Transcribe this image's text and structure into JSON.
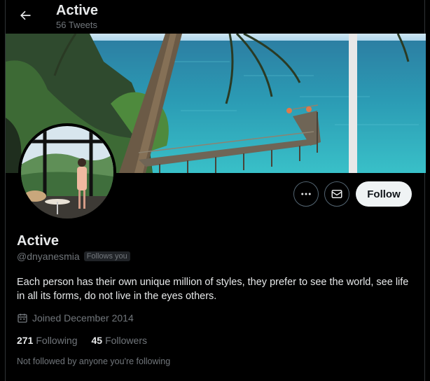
{
  "header": {
    "title": "Active",
    "tweet_count": "56 Tweets"
  },
  "actions": {
    "follow_label": "Follow"
  },
  "profile": {
    "name": "Active",
    "handle": "@dnyanesmia",
    "follows_you": "Follows you",
    "bio": "Each person has their own unique million of styles, they prefer to see the world, see life in all its forms,  do not live in the eyes others.",
    "joined": "Joined December 2014",
    "following_count": "271",
    "following_label": "Following",
    "followers_count": "45",
    "followers_label": "Followers",
    "mutuals_note": "Not followed by anyone you're following"
  },
  "icons": {
    "back": "arrow-left-icon",
    "more": "more-horizontal-icon",
    "message": "envelope-icon",
    "calendar": "calendar-icon"
  },
  "colors": {
    "background": "#000000",
    "text_primary": "#e7e9ea",
    "text_secondary": "#71767b",
    "follow_button_bg": "#eff3f4",
    "border": "#536471"
  }
}
